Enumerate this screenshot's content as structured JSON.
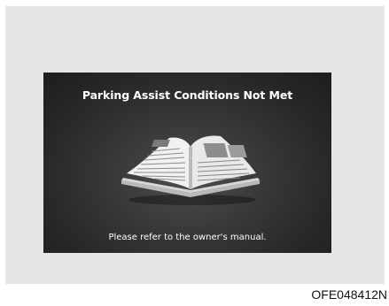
{
  "screen": {
    "title": "Parking Assist Conditions Not Met",
    "message": "Please refer to the owner's manual.",
    "image": "open-book-icon"
  },
  "figure_code": "OFE048412N",
  "colors": {
    "panel": "#e6e6e6",
    "screen": "#2a2a2a",
    "text": "#ffffff"
  }
}
